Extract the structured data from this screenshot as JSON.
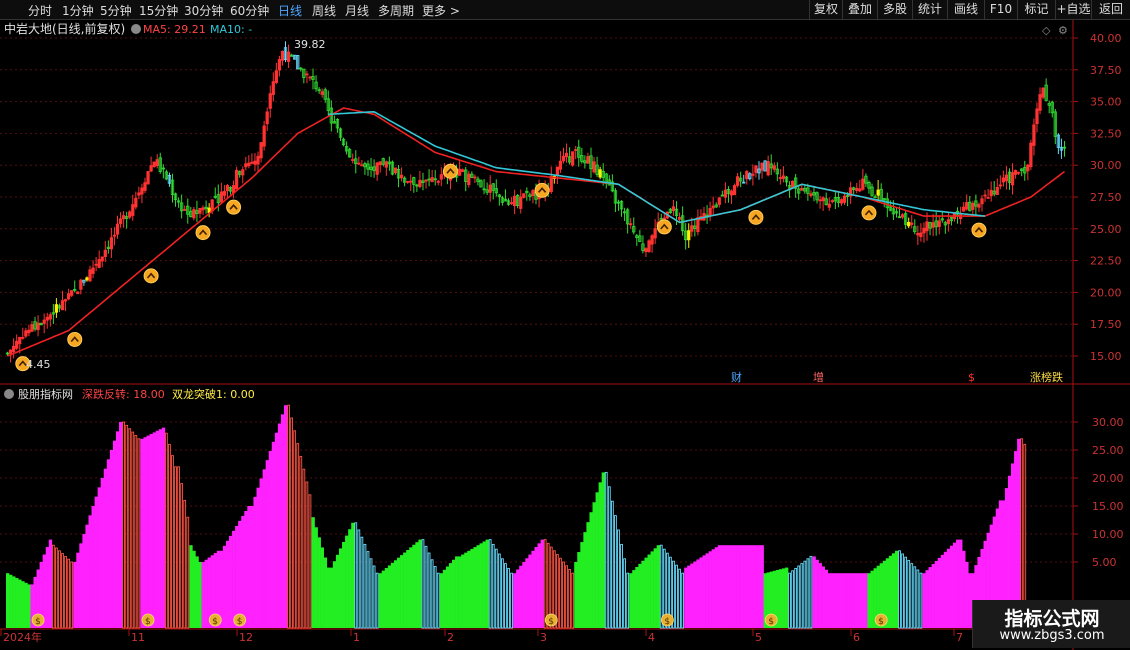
{
  "toolbar": {
    "timeframes": [
      "分时",
      "1分钟",
      "5分钟",
      "15分钟",
      "30分钟",
      "60分钟",
      "日线",
      "周线",
      "月线",
      "多周期",
      "更多 >"
    ],
    "active_index": 6,
    "right_buttons": [
      "复权",
      "叠加",
      "多股",
      "统计",
      "画线",
      "F10",
      "标记",
      "+自选",
      "返回"
    ]
  },
  "header": {
    "stock_title": "中岩大地(日线,前复权)",
    "ma5_label": "MA5: 29.21",
    "ma10_label": "MA10: -"
  },
  "annotations": {
    "high_label": "39.82",
    "low_label": "4.45"
  },
  "event_markers": [
    {
      "label": "财",
      "color": "#4fa8ff"
    },
    {
      "label": "增",
      "color": "#ff6666"
    },
    {
      "label": "$",
      "color": "#ff3333"
    },
    {
      "label": "涨榜跌",
      "color": "#ffdd44"
    }
  ],
  "indicator": {
    "name": "股朋指标网",
    "line1_label": "深跌反转: 18.00",
    "line2_label": "双龙突破1: 0.00"
  },
  "watermark": {
    "line1": "指标公式网",
    "line2": "www.zbgs3.com"
  },
  "colors": {
    "up": "#ff3333",
    "down": "#33dd33",
    "yellow": "#ffee00",
    "cyan": "#66ddff",
    "ma_red": "#ee2222",
    "ma_cyan": "#33c8d8",
    "magenta": "#ff22ff",
    "green": "#22ee22",
    "axis_red": "#aa1111"
  },
  "chart_data": [
    {
      "type": "candlestick",
      "title": "中岩大地(日线,前复权)",
      "ylim": [
        14.0,
        41.0
      ],
      "yticks": [
        15.0,
        17.5,
        20.0,
        22.5,
        25.0,
        27.5,
        30.0,
        32.5,
        35.0,
        37.5,
        40.0
      ],
      "x_month_labels": [
        "2024年",
        "11",
        "12",
        "1",
        "2",
        "3",
        "4",
        "5",
        "6",
        "7"
      ],
      "close_anchors": [
        [
          0,
          15.2
        ],
        [
          5,
          16.8
        ],
        [
          10,
          17.5
        ],
        [
          15,
          18.5
        ],
        [
          22,
          20.0
        ],
        [
          28,
          22.0
        ],
        [
          35,
          24.5
        ],
        [
          42,
          27.5
        ],
        [
          48,
          30.5
        ],
        [
          52,
          29.0
        ],
        [
          56,
          27.0
        ],
        [
          60,
          26.0
        ],
        [
          66,
          27.0
        ],
        [
          72,
          28.0
        ],
        [
          77,
          30.0
        ],
        [
          82,
          30.5
        ],
        [
          86,
          36.0
        ],
        [
          90,
          39.0
        ],
        [
          94,
          38.0
        ],
        [
          98,
          37.0
        ],
        [
          102,
          36.0
        ],
        [
          106,
          33.5
        ],
        [
          112,
          31.0
        ],
        [
          118,
          29.5
        ],
        [
          124,
          30.0
        ],
        [
          130,
          29.0
        ],
        [
          138,
          28.5
        ],
        [
          145,
          29.5
        ],
        [
          152,
          29.0
        ],
        [
          158,
          28.0
        ],
        [
          164,
          27.0
        ],
        [
          170,
          27.5
        ],
        [
          176,
          28.0
        ],
        [
          180,
          30.0
        ],
        [
          186,
          31.0
        ],
        [
          192,
          30.0
        ],
        [
          196,
          28.5
        ],
        [
          202,
          26.0
        ],
        [
          208,
          23.5
        ],
        [
          212,
          25.0
        ],
        [
          218,
          27.0
        ],
        [
          222,
          24.5
        ],
        [
          226,
          25.5
        ],
        [
          232,
          27.0
        ],
        [
          238,
          28.5
        ],
        [
          244,
          29.5
        ],
        [
          250,
          30.0
        ],
        [
          256,
          28.5
        ],
        [
          262,
          28.0
        ],
        [
          268,
          27.0
        ],
        [
          274,
          27.5
        ],
        [
          280,
          28.5
        ],
        [
          286,
          27.5
        ],
        [
          292,
          26.0
        ],
        [
          298,
          25.0
        ],
        [
          304,
          25.5
        ],
        [
          310,
          26.0
        ],
        [
          316,
          27.0
        ],
        [
          322,
          28.0
        ],
        [
          328,
          29.0
        ],
        [
          334,
          30.0
        ],
        [
          338,
          36.0
        ],
        [
          341,
          35.0
        ],
        [
          344,
          31.5
        ],
        [
          346,
          31.0
        ]
      ],
      "ma_red_anchors": [
        [
          0,
          15.0
        ],
        [
          20,
          17.0
        ],
        [
          40,
          21.0
        ],
        [
          60,
          25.0
        ],
        [
          80,
          29.0
        ],
        [
          95,
          32.5
        ],
        [
          110,
          34.5
        ],
        [
          120,
          34.0
        ],
        [
          140,
          31.0
        ],
        [
          160,
          29.5
        ],
        [
          180,
          29.0
        ],
        [
          200,
          28.5
        ],
        [
          220,
          25.5
        ],
        [
          240,
          26.5
        ],
        [
          260,
          28.5
        ],
        [
          280,
          27.5
        ],
        [
          300,
          26.0
        ],
        [
          320,
          26.0
        ],
        [
          335,
          27.5
        ],
        [
          346,
          29.5
        ]
      ],
      "ma_cyan_anchors": [
        [
          105,
          34.0
        ],
        [
          120,
          34.2
        ],
        [
          140,
          31.5
        ],
        [
          160,
          29.8
        ],
        [
          180,
          29.2
        ],
        [
          200,
          28.5
        ],
        [
          220,
          25.5
        ],
        [
          240,
          26.5
        ],
        [
          260,
          28.5
        ],
        [
          280,
          27.5
        ],
        [
          300,
          26.5
        ],
        [
          320,
          26.0
        ]
      ],
      "signal_indices": [
        5,
        22,
        47,
        64,
        74,
        145,
        175,
        215,
        245,
        282,
        318
      ]
    },
    {
      "type": "bar",
      "title": "股朋指标网",
      "ylim": [
        3.0,
        35.0
      ],
      "yticks": [
        5.0,
        10.0,
        15.0,
        20.0,
        25.0,
        30.0
      ],
      "segments": [
        {
          "x": [
            0,
            8
          ],
          "v": [
            3,
            1
          ],
          "c": "g"
        },
        {
          "x": [
            8,
            15
          ],
          "v": [
            1,
            9
          ],
          "c": "m"
        },
        {
          "x": [
            15,
            22
          ],
          "v": [
            8,
            5
          ],
          "c": "r"
        },
        {
          "x": [
            22,
            38
          ],
          "v": [
            5,
            30
          ],
          "c": "m"
        },
        {
          "x": [
            38,
            44
          ],
          "v": [
            30,
            27
          ],
          "c": "r"
        },
        {
          "x": [
            44,
            52
          ],
          "v": [
            27,
            29
          ],
          "c": "m"
        },
        {
          "x": [
            52,
            56
          ],
          "v": [
            28,
            22
          ],
          "c": "r"
        },
        {
          "x": [
            56,
            60
          ],
          "v": [
            22,
            13
          ],
          "c": "r"
        },
        {
          "x": [
            60,
            64
          ],
          "v": [
            8,
            5
          ],
          "c": "g"
        },
        {
          "x": [
            64,
            70
          ],
          "v": [
            5,
            7
          ],
          "c": "m"
        },
        {
          "x": [
            70,
            80
          ],
          "v": [
            7,
            15
          ],
          "c": "m"
        },
        {
          "x": [
            80,
            92
          ],
          "v": [
            15,
            33
          ],
          "c": "m"
        },
        {
          "x": [
            92,
            100
          ],
          "v": [
            33,
            17
          ],
          "c": "r"
        },
        {
          "x": [
            100,
            106
          ],
          "v": [
            13,
            4
          ],
          "c": "g"
        },
        {
          "x": [
            106,
            114
          ],
          "v": [
            4,
            12
          ],
          "c": "g"
        },
        {
          "x": [
            114,
            122
          ],
          "v": [
            12,
            3
          ],
          "c": "c"
        },
        {
          "x": [
            122,
            136
          ],
          "v": [
            3,
            9
          ],
          "c": "g"
        },
        {
          "x": [
            136,
            142
          ],
          "v": [
            9,
            3
          ],
          "c": "c"
        },
        {
          "x": [
            142,
            148
          ],
          "v": [
            3,
            6
          ],
          "c": "g"
        },
        {
          "x": [
            148,
            158
          ],
          "v": [
            6,
            9
          ],
          "c": "g"
        },
        {
          "x": [
            158,
            166
          ],
          "v": [
            9,
            3
          ],
          "c": "c"
        },
        {
          "x": [
            166,
            176
          ],
          "v": [
            3,
            9
          ],
          "c": "m"
        },
        {
          "x": [
            176,
            186
          ],
          "v": [
            9,
            3
          ],
          "c": "r"
        },
        {
          "x": [
            186,
            196
          ],
          "v": [
            5,
            21
          ],
          "c": "g"
        },
        {
          "x": [
            196,
            204
          ],
          "v": [
            21,
            3
          ],
          "c": "c"
        },
        {
          "x": [
            204,
            214
          ],
          "v": [
            3,
            8
          ],
          "c": "g"
        },
        {
          "x": [
            214,
            222
          ],
          "v": [
            8,
            3
          ],
          "c": "c"
        },
        {
          "x": [
            222,
            234
          ],
          "v": [
            4,
            8
          ],
          "c": "m"
        },
        {
          "x": [
            234,
            248
          ],
          "v": [
            8,
            8
          ],
          "c": "m"
        },
        {
          "x": [
            248,
            256
          ],
          "v": [
            3,
            4
          ],
          "c": "g"
        },
        {
          "x": [
            256,
            264
          ],
          "v": [
            3,
            6
          ],
          "c": "c"
        },
        {
          "x": [
            264,
            270
          ],
          "v": [
            6,
            3
          ],
          "c": "m"
        },
        {
          "x": [
            270,
            282
          ],
          "v": [
            3,
            3
          ],
          "c": "m"
        },
        {
          "x": [
            282,
            292
          ],
          "v": [
            3,
            7
          ],
          "c": "g"
        },
        {
          "x": [
            292,
            300
          ],
          "v": [
            7,
            3
          ],
          "c": "c"
        },
        {
          "x": [
            300,
            312
          ],
          "v": [
            3,
            9
          ],
          "c": "m"
        },
        {
          "x": [
            312,
            316
          ],
          "v": [
            9,
            3
          ],
          "c": "m"
        },
        {
          "x": [
            316,
            326
          ],
          "v": [
            3,
            16
          ],
          "c": "m"
        },
        {
          "x": [
            326,
            332
          ],
          "v": [
            16,
            27
          ],
          "c": "m"
        },
        {
          "x": [
            332,
            334
          ],
          "v": [
            27,
            26
          ],
          "c": "r"
        }
      ],
      "coin_indices": [
        10,
        46,
        68,
        76,
        178,
        216,
        250,
        286,
        320
      ]
    }
  ]
}
